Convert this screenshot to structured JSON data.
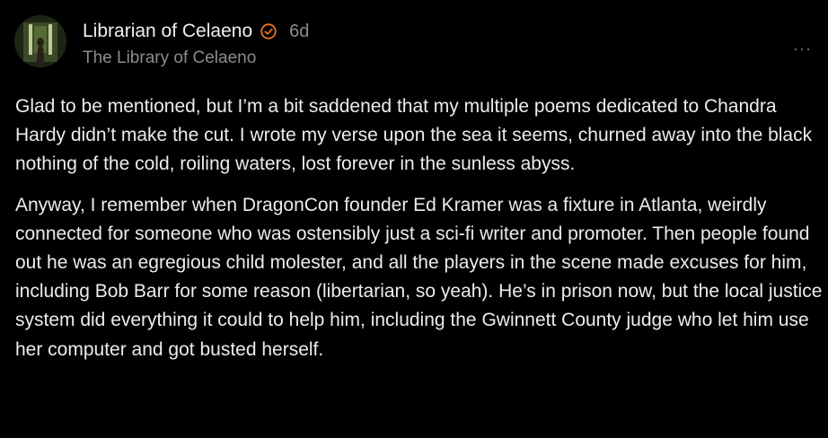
{
  "comment": {
    "author": "Librarian of Celaeno",
    "age": "6d",
    "publication": "The Library of Celaeno",
    "more_label": "···",
    "paragraphs": [
      "Glad to be mentioned, but I’m a bit saddened that my multiple poems dedicated to Chandra Hardy didn’t make the cut. I wrote my verse upon the sea it seems, churned away into the black nothing of the cold, roiling waters, lost forever in the sunless abyss.",
      "Anyway, I remember when DragonCon founder Ed Kramer was a fixture in Atlanta, weirdly connected for someone who was ostensibly just a sci-fi writer and promoter. Then people found out he was an egregious child molester, and all the players in the scene made excuses for him, including Bob Barr for some reason (libertarian, so yeah). He’s in prison now, but the local justice system did everything it could to help him, including the Gwinnett County judge who let him use her computer and got busted herself."
    ]
  },
  "icons": {
    "verified": "verified-check-icon",
    "more": "more-options-icon"
  },
  "colors": {
    "background": "#000000",
    "text": "#ececec",
    "muted": "#8b8b8b",
    "accent": "#e8731f"
  }
}
